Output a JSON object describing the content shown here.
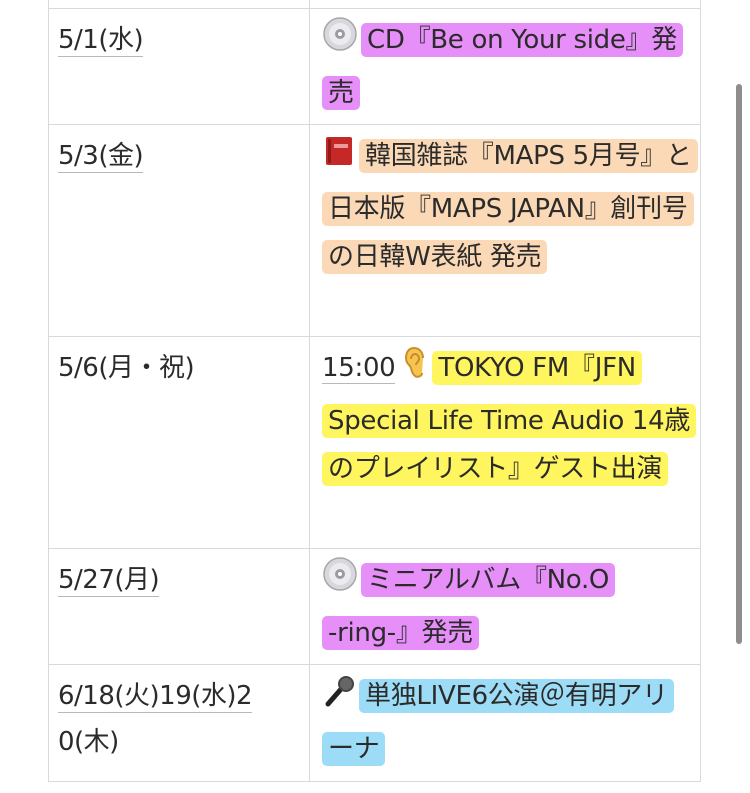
{
  "rows": [
    {
      "date": "5/1(水)",
      "icon": "cd-icon",
      "highlight": "#e78ff8",
      "text": "CD『Be on Your side』発売"
    },
    {
      "date": "5/3(金)",
      "icon": "book-icon",
      "highlight": "#fbd9b6",
      "text": "韓国雑誌『MAPS 5月号』と日本版『MAPS JAPAN』創刊号の日韓W表紙 発売"
    },
    {
      "date": "5/6(月・祝)",
      "icon": "ear-icon",
      "highlight": "#fff55f",
      "time": "15:00",
      "text": "TOKYO FM『JFN Special Life Time Audio 14歳のプレイリスト』ゲスト出演"
    },
    {
      "date": "5/27(月)",
      "icon": "cd-icon",
      "highlight": "#e78ff8",
      "text": "ミニアルバム『No.O -ring-』発売"
    },
    {
      "date_line1": "6/18(火)19(水)2",
      "date_line2": "0(木)",
      "icon": "microphone-icon",
      "highlight": "#9ddcf6",
      "text": "単独LIVE6公演＠有明アリーナ"
    }
  ]
}
